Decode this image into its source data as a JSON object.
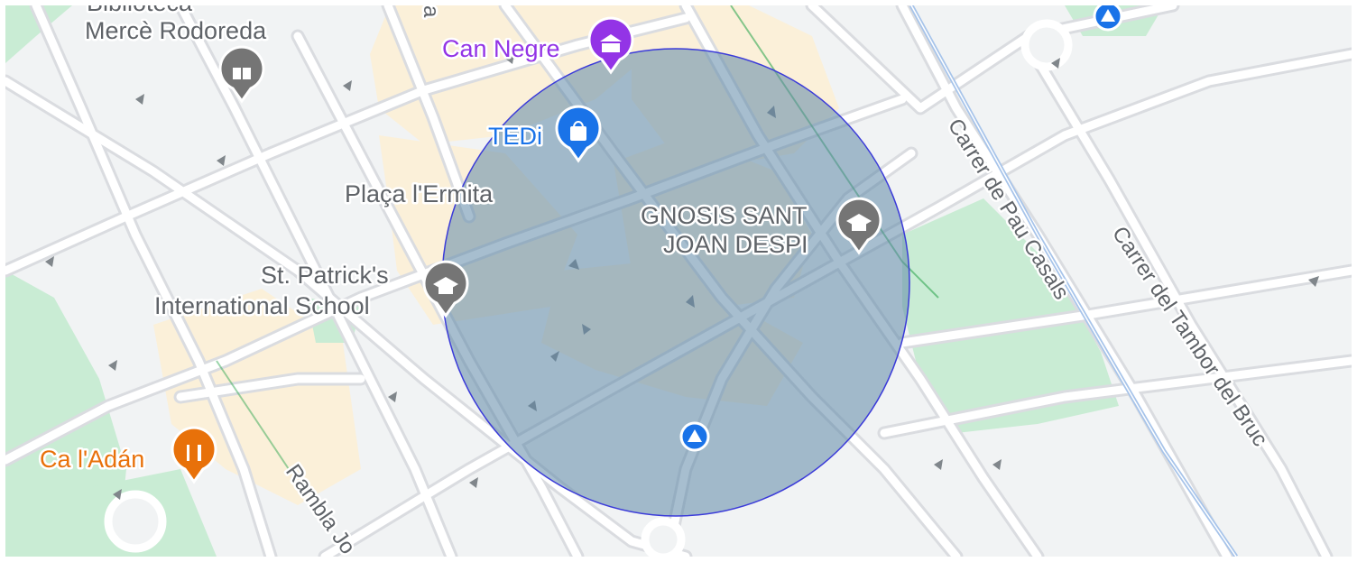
{
  "map": {
    "colors": {
      "background": "#f1f3f4",
      "road": "#ffffff",
      "road_casing": "#dadce0",
      "park": "#c9ecd4",
      "built_area": "#fbf0d9",
      "rail": "#a7c4ea",
      "circle_fill": "#5f88a8",
      "circle_stroke": "#3b3bd9",
      "label_gray": "#5f6368",
      "label_purple": "#9334e6",
      "label_blue": "#1a73e8",
      "label_orange": "#e8710a"
    },
    "pois": [
      {
        "name": "Biblioteca",
        "icon": "building-icon",
        "color": "#5f6368"
      },
      {
        "name": "Mercè Rodoreda",
        "icon": "book-icon",
        "color": "#5f6368"
      },
      {
        "name": "Can Negre",
        "icon": "museum-icon",
        "color": "#9334e6"
      },
      {
        "name": "TEDi",
        "icon": "shopping-bag-icon",
        "color": "#1a73e8"
      },
      {
        "name": "Plaça l'Ermita",
        "icon": "",
        "color": "#5f6368"
      },
      {
        "name": "GNOSIS SANT",
        "icon": "school-icon",
        "color": "#5f6368"
      },
      {
        "name": "JOAN DESPI",
        "icon": "",
        "color": "#5f6368"
      },
      {
        "name": "St. Patrick's",
        "icon": "school-icon",
        "color": "#5f6368"
      },
      {
        "name": "International School",
        "icon": "",
        "color": "#5f6368"
      },
      {
        "name": "Ca l'Adán",
        "icon": "restaurant-icon",
        "color": "#e8710a"
      }
    ],
    "streets": [
      "Carrer de Pau Casals",
      "Carrer del Tambor del Bruc",
      "Rambla Jo",
      "a"
    ],
    "transit_icons": [
      "tram-icon",
      "tram-icon"
    ]
  }
}
